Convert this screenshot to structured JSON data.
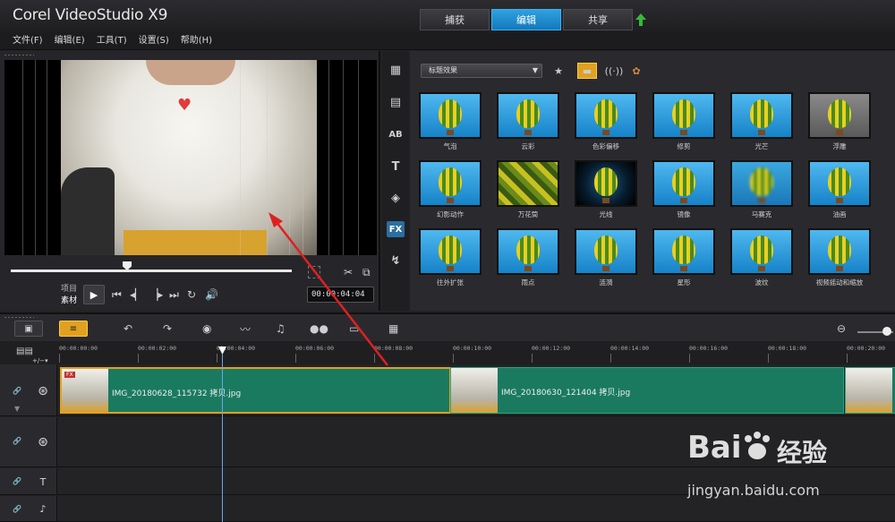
{
  "app": {
    "title": "Corel VideoStudio X9",
    "tabs": [
      {
        "label": "捕获",
        "active": false
      },
      {
        "label": "编辑",
        "active": true
      },
      {
        "label": "共享",
        "active": false
      }
    ]
  },
  "menu": [
    "文件(F)",
    "编辑(E)",
    "工具(T)",
    "设置(S)",
    "帮助(H)"
  ],
  "preview": {
    "mode_labels": [
      "项目",
      "素材"
    ],
    "timecode": "00:00:04:04",
    "scrub_position": 0.42
  },
  "library": {
    "dropdown_value": "标题效果",
    "effects": [
      {
        "label": "气泡",
        "style": "normal"
      },
      {
        "label": "云彩",
        "style": "normal"
      },
      {
        "label": "色彩偏移",
        "style": "normal"
      },
      {
        "label": "修剪",
        "style": "normal"
      },
      {
        "label": "光芒",
        "style": "normal"
      },
      {
        "label": "浮雕",
        "style": "grey"
      },
      {
        "label": "幻影动作",
        "style": "normal"
      },
      {
        "label": "万花筒",
        "style": "kaleido"
      },
      {
        "label": "光线",
        "style": "dark"
      },
      {
        "label": "镜像",
        "style": "normal"
      },
      {
        "label": "马赛克",
        "style": "mosaic"
      },
      {
        "label": "油画",
        "style": "normal"
      },
      {
        "label": "往外扩张",
        "style": "normal"
      },
      {
        "label": "雨点",
        "style": "normal"
      },
      {
        "label": "涟漪",
        "style": "normal"
      },
      {
        "label": "星形",
        "style": "normal"
      },
      {
        "label": "波纹",
        "style": "normal"
      },
      {
        "label": "视频摇动和缩放",
        "style": "normal"
      }
    ]
  },
  "timeline": {
    "ruler": [
      "00:00:00:00",
      "00:00:02:00",
      "00:00:04:00",
      "00:00:06:00",
      "00:00:08:00",
      "00:00:10:00",
      "00:00:12:00",
      "00:00:14:00",
      "00:00:16:00",
      "00:00:18:00",
      "00:00:20:00"
    ],
    "clips": [
      {
        "name": "IMG_20180628_115732 拷贝.jpg",
        "fx": "FX"
      },
      {
        "name": "IMG_20180630_121404 拷贝.jpg"
      }
    ]
  },
  "watermark": {
    "logo_left": "Bai",
    "logo_right": "经验",
    "url": "jingyan.baidu.com"
  },
  "colors": {
    "accent_blue": "#1e8fd6",
    "clip_green": "#1a7a60",
    "selection_orange": "#e0a020",
    "annotation_red": "#e02020"
  }
}
